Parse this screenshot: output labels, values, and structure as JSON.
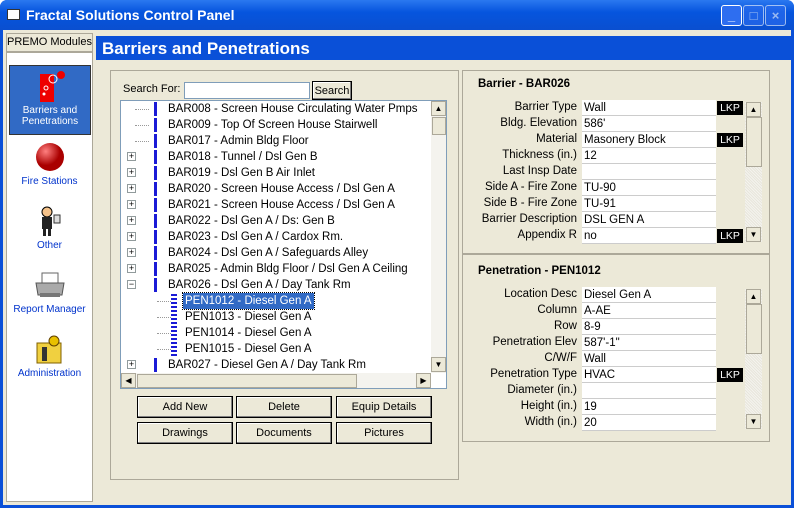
{
  "window": {
    "title": "Fractal Solutions Control Panel",
    "controls": [
      "_",
      "□",
      "×"
    ]
  },
  "sidebar": {
    "tab": "PREMO Modules",
    "items": [
      {
        "label": "Barriers and Penetrations",
        "icon": "barrier-icon"
      },
      {
        "label": "Fire Stations",
        "icon": "fire-station-icon"
      },
      {
        "label": "Other",
        "icon": "person-icon"
      },
      {
        "label": "Report Manager",
        "icon": "printer-icon"
      },
      {
        "label": "Administration",
        "icon": "admin-key-icon"
      }
    ]
  },
  "header": {
    "title": "Barriers and Penetrations"
  },
  "search": {
    "label": "Search For:",
    "value": "",
    "button": "Search"
  },
  "tree": {
    "items": [
      {
        "text": "BAR008 - Screen House Circulating Water Pmps",
        "level": 0,
        "expander": ""
      },
      {
        "text": "BAR009 - Top Of Screen House Stairwell",
        "level": 0,
        "expander": ""
      },
      {
        "text": "BAR017 - Admin Bldg Floor",
        "level": 0,
        "expander": ""
      },
      {
        "text": "BAR018 - Tunnel / Dsl Gen B",
        "level": 0,
        "expander": "+"
      },
      {
        "text": "BAR019 - Dsl Gen B Air Inlet",
        "level": 0,
        "expander": "+"
      },
      {
        "text": "BAR020 - Screen House Access / Dsl Gen A",
        "level": 0,
        "expander": "+"
      },
      {
        "text": "BAR021 - Screen House Access / Dsl Gen A",
        "level": 0,
        "expander": "+"
      },
      {
        "text": "BAR022 - Dsl Gen A / Ds: Gen B",
        "level": 0,
        "expander": "+"
      },
      {
        "text": "BAR023 - Dsl Gen A / Cardox Rm.",
        "level": 0,
        "expander": "+"
      },
      {
        "text": "BAR024 - Dsl Gen A / Safeguards Alley",
        "level": 0,
        "expander": "+"
      },
      {
        "text": "BAR025 - Admin Bldg Floor / Dsl Gen A Ceiling",
        "level": 0,
        "expander": "+"
      },
      {
        "text": "BAR026 - Dsl Gen A / Day Tank Rm",
        "level": 0,
        "expander": "-"
      },
      {
        "text": "PEN1012 - Diesel Gen A",
        "level": 1,
        "expander": "",
        "selected": true
      },
      {
        "text": "PEN1013 - Diesel Gen A",
        "level": 1,
        "expander": ""
      },
      {
        "text": "PEN1014 - Diesel Gen A",
        "level": 1,
        "expander": ""
      },
      {
        "text": "PEN1015 - Diesel Gen A",
        "level": 1,
        "expander": ""
      },
      {
        "text": "BAR027 - Diesel Gen A /  Day Tank Rm",
        "level": 0,
        "expander": "+"
      }
    ]
  },
  "buttons": [
    "Add New",
    "Delete",
    "Equip Details",
    "Drawings",
    "Documents",
    "Pictures"
  ],
  "barrier": {
    "title": "Barrier - BAR026",
    "fields": [
      {
        "label": "Barrier Type",
        "value": "Wall",
        "lkp": "LKP"
      },
      {
        "label": "Bldg. Elevation",
        "value": "586'"
      },
      {
        "label": "Material",
        "value": "Masonery Block",
        "lkp": "LKP"
      },
      {
        "label": "Thickness (in.)",
        "value": "12"
      },
      {
        "label": "Last Insp Date",
        "value": ""
      },
      {
        "label": "Side A - Fire Zone",
        "value": "TU-90"
      },
      {
        "label": "Side B - Fire Zone",
        "value": "TU-91"
      },
      {
        "label": "Barrier Description",
        "value": "DSL GEN A"
      },
      {
        "label": "Appendix R",
        "value": "no",
        "lkp": "LKP"
      }
    ]
  },
  "penetration": {
    "title": "Penetration - PEN1012",
    "fields": [
      {
        "label": "Location Desc",
        "value": "Diesel Gen A"
      },
      {
        "label": "Column",
        "value": "A-AE"
      },
      {
        "label": "Row",
        "value": "8-9"
      },
      {
        "label": "Penetration Elev",
        "value": "587'-1\""
      },
      {
        "label": "C/W/F",
        "value": "Wall"
      },
      {
        "label": "Penetration Type",
        "value": "HVAC",
        "lkp": "LKP"
      },
      {
        "label": "Diameter (in.)",
        "value": ""
      },
      {
        "label": "Height (in.)",
        "value": "19"
      },
      {
        "label": "Width (in.)",
        "value": "20"
      }
    ]
  },
  "colors": {
    "titlebar": "#0a50d8",
    "selection": "#316ac5",
    "tree_marker": "#1b1bd6",
    "lkp": "#000000"
  }
}
